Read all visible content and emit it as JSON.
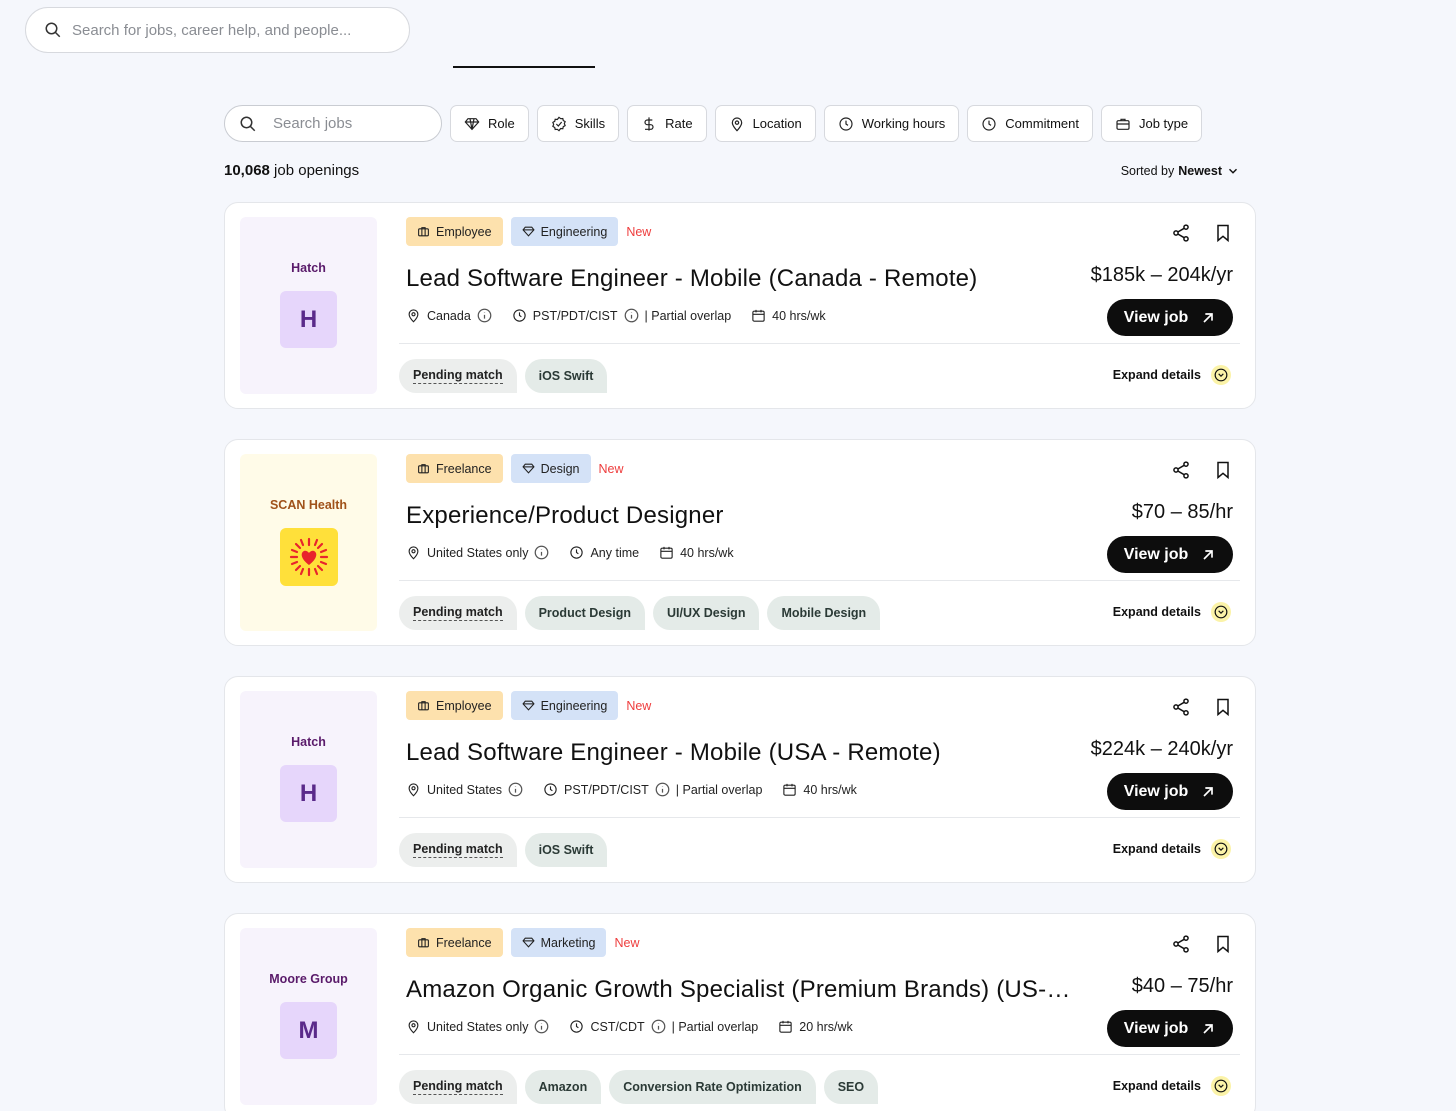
{
  "top_search": {
    "placeholder": "Search for jobs, career help, and people..."
  },
  "filters": {
    "search_placeholder": "Search jobs",
    "buttons": [
      {
        "label": "Role",
        "icon": "diamond-icon"
      },
      {
        "label": "Skills",
        "icon": "badge-check-icon"
      },
      {
        "label": "Rate",
        "icon": "dollar-icon"
      },
      {
        "label": "Location",
        "icon": "map-pin-icon"
      },
      {
        "label": "Working hours",
        "icon": "clock-icon"
      },
      {
        "label": "Commitment",
        "icon": "clock-icon"
      },
      {
        "label": "Job type",
        "icon": "briefcase-icon"
      }
    ]
  },
  "results": {
    "count": "10,068",
    "count_suffix": " job openings",
    "sort_prefix": "Sorted by ",
    "sort_value": "Newest"
  },
  "common": {
    "view_job": "View job",
    "expand_details": "Expand details",
    "pending_match": "Pending match",
    "new_label": "New"
  },
  "colors": {
    "purple_logo_bg": "#f7f3fc",
    "yellow_logo_bg": "#fffbe8",
    "hatch_name": "#5a1a6a",
    "scan_name": "#a0521a",
    "new_red": "#ee3d3d"
  },
  "jobs": [
    {
      "company": "Hatch",
      "letter": "H",
      "type": "Employee",
      "role": "Engineering",
      "title": "Lead Software Engineer - Mobile (Canada - Remote)",
      "location": "Canada",
      "timezone": "PST/PDT/CIST",
      "overlap": "| Partial overlap",
      "hours": "40 hrs/wk",
      "salary": "$185k – 204k/yr",
      "skills": [
        "iOS Swift"
      ]
    },
    {
      "company": "SCAN Health",
      "letter": "",
      "type": "Freelance",
      "role": "Design",
      "title": "Experience/Product Designer",
      "location": "United States only",
      "timezone": "Any time",
      "overlap": "",
      "hours": "40 hrs/wk",
      "salary": "$70 – 85/hr",
      "skills": [
        "Product Design",
        "UI/UX Design",
        "Mobile Design"
      ]
    },
    {
      "company": "Hatch",
      "letter": "H",
      "type": "Employee",
      "role": "Engineering",
      "title": "Lead Software Engineer - Mobile (USA - Remote)",
      "location": "United States",
      "timezone": "PST/PDT/CIST",
      "overlap": "| Partial overlap",
      "hours": "40 hrs/wk",
      "salary": "$224k – 240k/yr",
      "skills": [
        "iOS Swift"
      ]
    },
    {
      "company": "Moore Group",
      "letter": "M",
      "type": "Freelance",
      "role": "Marketing",
      "title": "Amazon Organic Growth Specialist (Premium Brands) (US-…",
      "location": "United States only",
      "timezone": "CST/CDT",
      "overlap": "| Partial overlap",
      "hours": "20 hrs/wk",
      "salary": "$40 – 75/hr",
      "skills": [
        "Amazon",
        "Conversion Rate Optimization",
        "SEO"
      ]
    }
  ]
}
